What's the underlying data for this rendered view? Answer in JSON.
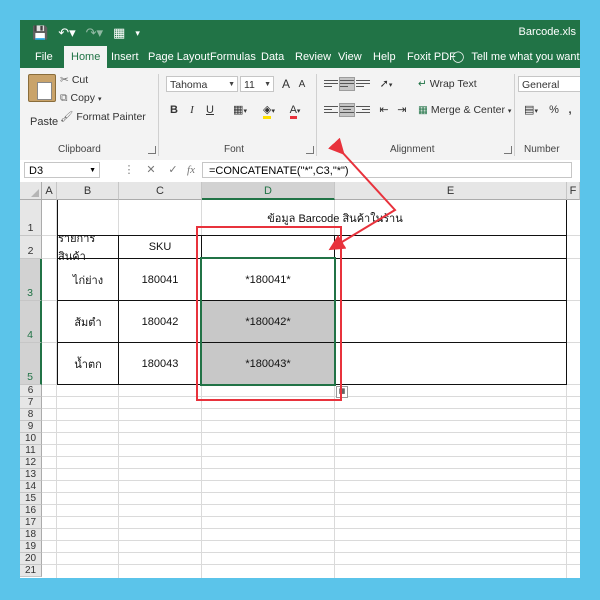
{
  "titlebar": {
    "save_icon": "save-icon",
    "filename": "Barcode.xls"
  },
  "tabs": [
    "File",
    "Home",
    "Insert",
    "Page Layout",
    "Formulas",
    "Data",
    "Review",
    "View",
    "Help",
    "Foxit PDF"
  ],
  "tell_me": "Tell me what you want to",
  "clipboard": {
    "paste": "Paste",
    "cut": "Cut",
    "copy": "Copy",
    "format_painter": "Format Painter",
    "group_label": "Clipboard"
  },
  "font": {
    "name": "Tahoma",
    "size": "11",
    "bold": "B",
    "italic": "I",
    "underline": "U",
    "grow": "A",
    "shrink": "A",
    "font_color_glyph": "A",
    "group_label": "Font"
  },
  "alignment": {
    "wrap_text": "Wrap Text",
    "merge_center": "Merge & Center",
    "group_label": "Alignment"
  },
  "number": {
    "format": "General",
    "percent": "%",
    "comma": ",",
    "group_label": "Number"
  },
  "formula_bar": {
    "name_box": "D3",
    "formula": "=CONCATENATE(\"*\",C3,\"*\")",
    "fx": "fx"
  },
  "columns": [
    "A",
    "B",
    "C",
    "D",
    "E",
    "F"
  ],
  "rows": [
    "1",
    "2",
    "3",
    "4",
    "5",
    "6",
    "7",
    "8",
    "9",
    "10",
    "11",
    "12",
    "13",
    "14",
    "15",
    "16",
    "17",
    "18",
    "19",
    "20",
    "21"
  ],
  "sheet": {
    "title": "ข้อมูล Barcode สินค้าในร้าน",
    "headers": {
      "item": "รายการสินค้า",
      "sku": "SKU",
      "barcode": ""
    },
    "items": [
      {
        "name": "ไก่ย่าง",
        "sku": "180041",
        "barcode": "*180041*"
      },
      {
        "name": "ส้มตำ",
        "sku": "180042",
        "barcode": "*180042*"
      },
      {
        "name": "น้ำตก",
        "sku": "180043",
        "barcode": "*180043*"
      }
    ]
  },
  "colors": {
    "excel_green": "#217346",
    "annotation_red": "#e8323c",
    "background": "#5bc4ea"
  }
}
